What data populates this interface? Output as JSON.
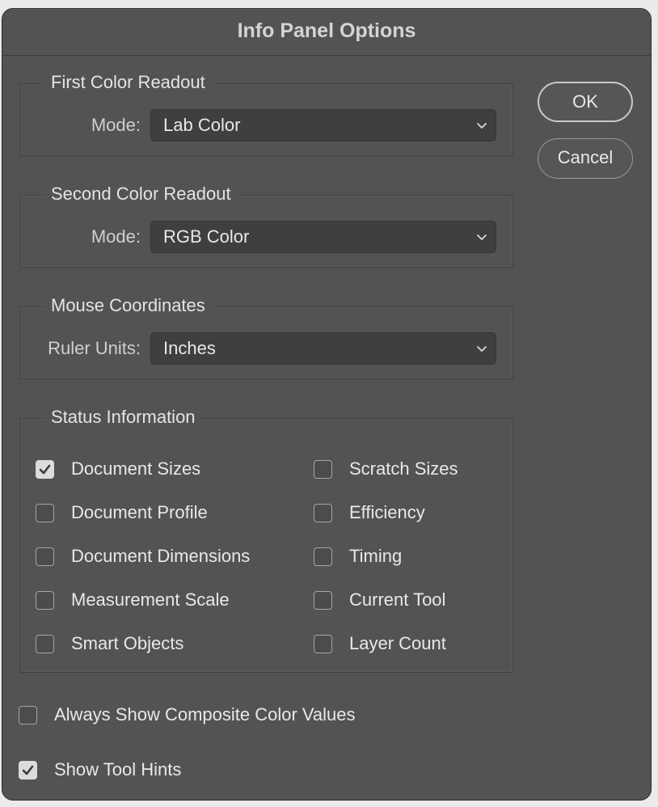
{
  "dialog": {
    "title": "Info Panel Options"
  },
  "buttons": {
    "ok_label": "OK",
    "cancel_label": "Cancel"
  },
  "first_readout": {
    "title": "First Color Readout",
    "mode_label": "Mode:",
    "mode_value": "Lab Color"
  },
  "second_readout": {
    "title": "Second Color Readout",
    "mode_label": "Mode:",
    "mode_value": "RGB Color"
  },
  "mouse_coordinates": {
    "title": "Mouse Coordinates",
    "units_label": "Ruler Units:",
    "units_value": "Inches"
  },
  "status": {
    "title": "Status Information",
    "items": [
      {
        "label": "Document Sizes",
        "checked": true
      },
      {
        "label": "Document Profile",
        "checked": false
      },
      {
        "label": "Document Dimensions",
        "checked": false
      },
      {
        "label": "Measurement Scale",
        "checked": false
      },
      {
        "label": "Smart Objects",
        "checked": false
      },
      {
        "label": "Scratch Sizes",
        "checked": false
      },
      {
        "label": "Efficiency",
        "checked": false
      },
      {
        "label": "Timing",
        "checked": false
      },
      {
        "label": "Current Tool",
        "checked": false
      },
      {
        "label": "Layer Count",
        "checked": false
      }
    ]
  },
  "options": {
    "composite_label": "Always Show Composite Color Values",
    "composite_checked": false,
    "tool_hints_label": "Show Tool Hints",
    "tool_hints_checked": true
  },
  "icons": {
    "dropdown": "chevron-down-icon",
    "check": "checkmark-icon"
  },
  "colors": {
    "dialog_bg": "#535353",
    "field_bg": "#3f3f3f",
    "text": "#e8e8e8"
  }
}
